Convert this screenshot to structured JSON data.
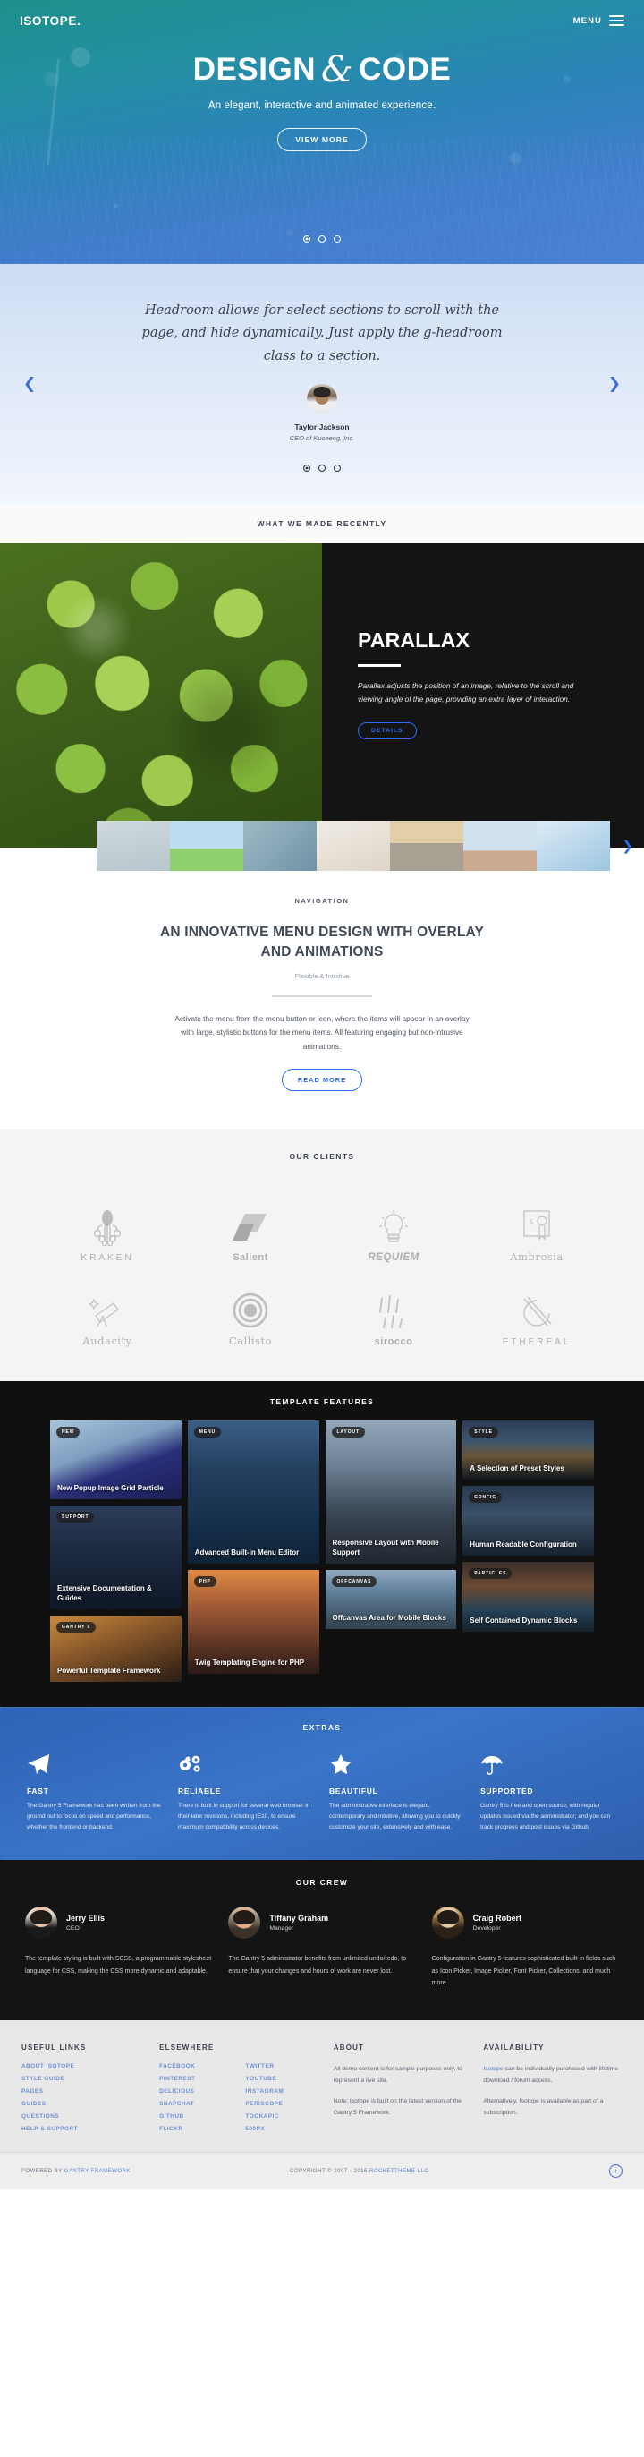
{
  "header": {
    "logo": "ISOTOPE.",
    "menu_label": "MENU"
  },
  "hero": {
    "title_left": "DESIGN",
    "amp": "&",
    "title_right": "CODE",
    "subtitle": "An elegant, interactive and animated experience.",
    "cta": "VIEW MORE"
  },
  "testimonial": {
    "quote": "Headroom allows for select sections to scroll with the page, and hide dynamically. Just apply the g-headroom class to a section.",
    "name": "Taylor Jackson",
    "role": "CEO of Kuceeng, Inc.",
    "prev_icon": "chevron-left-icon",
    "next_icon": "chevron-right-icon"
  },
  "showcase": {
    "eyebrow": "WHAT WE MADE RECENTLY",
    "title": "PARALLAX",
    "body": "Parallax adjusts the position of an image, relative to the scroll and viewing angle of the page, providing an extra layer of interaction.",
    "cta": "DETAILS"
  },
  "navigation": {
    "eyebrow": "NAVIGATION",
    "heading": "AN INNOVATIVE MENU DESIGN WITH OVERLAY AND ANIMATIONS",
    "subheading": "Flexible & Intuitive",
    "body": "Activate the menu from the menu button or icon, where the items will appear in an overlay with large, stylistic buttons for the menu items. All featuring engaging but non-intrusive animations.",
    "cta": "READ MORE"
  },
  "clients": {
    "title": "OUR CLIENTS",
    "items": [
      {
        "name": "KRAKEN",
        "icon": "octopus-icon"
      },
      {
        "name": "Salient",
        "icon": "parallelogram-icon"
      },
      {
        "name": "REQUIEM",
        "icon": "lightbulb-icon"
      },
      {
        "name": "Ambrosia",
        "icon": "certificate-icon"
      },
      {
        "name": "Audacity",
        "icon": "telescope-icon"
      },
      {
        "name": "Callisto",
        "icon": "concentric-circles-icon"
      },
      {
        "name": "sirocco",
        "icon": "wind-lines-icon"
      },
      {
        "name": "ETHEREAL",
        "icon": "crossed-circle-icon"
      }
    ]
  },
  "features": {
    "title": "TEMPLATE FEATURES",
    "columns": [
      [
        {
          "tag": "NEW",
          "caption": "New Popup Image Grid Particle"
        },
        {
          "tag": "SUPPORT",
          "caption": "Extensive Documentation & Guides"
        },
        {
          "tag": "GANTRY 5",
          "caption": "Powerful Template Framework"
        }
      ],
      [
        {
          "tag": "MENU",
          "caption": "Advanced Built-in Menu Editor"
        },
        {
          "tag": "PHP",
          "caption": "Twig Templating Engine for PHP"
        }
      ],
      [
        {
          "tag": "LAYOUT",
          "caption": "Responsive Layout with Mobile Support"
        },
        {
          "tag": "OFFCANVAS",
          "caption": "Offcanvas Area for Mobile Blocks"
        }
      ],
      [
        {
          "tag": "STYLE",
          "caption": "A Selection of Preset Styles"
        },
        {
          "tag": "CONFIG",
          "caption": "Human Readable Configuration"
        },
        {
          "tag": "PARTICLES",
          "caption": "Self Contained Dynamic Blocks"
        }
      ]
    ]
  },
  "extras": {
    "title": "EXTRAS",
    "items": [
      {
        "icon": "paper-plane-icon",
        "heading": "FAST",
        "body": "The Gantry 5 Framework has been written from the ground out to focus on speed and performance, whether the frontend or backend."
      },
      {
        "icon": "gears-icon",
        "heading": "RELIABLE",
        "body": "There is built in support for several web browser in their later revisions, including IE10, to ensure maximum compatibility across devices."
      },
      {
        "icon": "star-icon",
        "heading": "BEAUTIFUL",
        "body": "The administrative interface is elegant, contemporary and intuitive, allowing you to quickly customize your site, extensively and with ease."
      },
      {
        "icon": "umbrella-icon",
        "heading": "SUPPORTED",
        "body": "Gantry 5 is free and open source, with regular updates issued via the administrator; and you can track progress and post issues via Github."
      }
    ]
  },
  "crew": {
    "title": "OUR CREW",
    "members": [
      {
        "name": "Jerry Ellis",
        "role": "CEO",
        "body": "The template styling is built with SCSS, a programmable stylesheet language for CSS, making the CSS more dynamic and adaptable."
      },
      {
        "name": "Tiffany Graham",
        "role": "Manager",
        "body": "The Gantry 5 administrator benefits from unlimited undo/redo, to ensure that your changes and hours of work are never lost."
      },
      {
        "name": "Craig Robert",
        "role": "Developer",
        "body": "Configuration in Gantry 5 features sophisticated built-in fields such as Icon Picker, Image Picker, Font Picker, Collections, and much more."
      }
    ]
  },
  "footer": {
    "useful_links": {
      "title": "USEFUL LINKS",
      "items": [
        "ABOUT ISOTOPE",
        "STYLE GUIDE",
        "PAGES",
        "GUIDES",
        "QUESTIONS",
        "HELP & SUPPORT"
      ]
    },
    "elsewhere": {
      "title": "ELSEWHERE",
      "items": [
        "FACEBOOK",
        "TWITTER",
        "PINTEREST",
        "YOUTUBE",
        "DELICIOUS",
        "INSTAGRAM",
        "SNAPCHAT",
        "PERISCOPE",
        "GITHUB",
        "TOOKAPIC",
        "FLICKR",
        "500PX"
      ]
    },
    "about": {
      "title": "ABOUT",
      "p1": "All demo content is for sample purposes only, to represent a live site.",
      "p2": "Note: Isotope is built on the latest version of the Gantry 5 Framework."
    },
    "availability": {
      "title": "AVAILABILITY",
      "p1_link": "Isotope",
      "p1": " can be individually purchased with lifetime download / forum access.",
      "p2": "Alternatively, Isotope is available as part of a subscription."
    },
    "copyright": {
      "powered_prefix": "POWERED BY ",
      "powered_link": "GANTRY FRAMEWORK",
      "copy_prefix": "COPYRIGHT © 2007 - 2016 ",
      "copy_link": "ROCKETTHEME LLC",
      "top_icon": "arrow-up-circle-icon"
    }
  }
}
